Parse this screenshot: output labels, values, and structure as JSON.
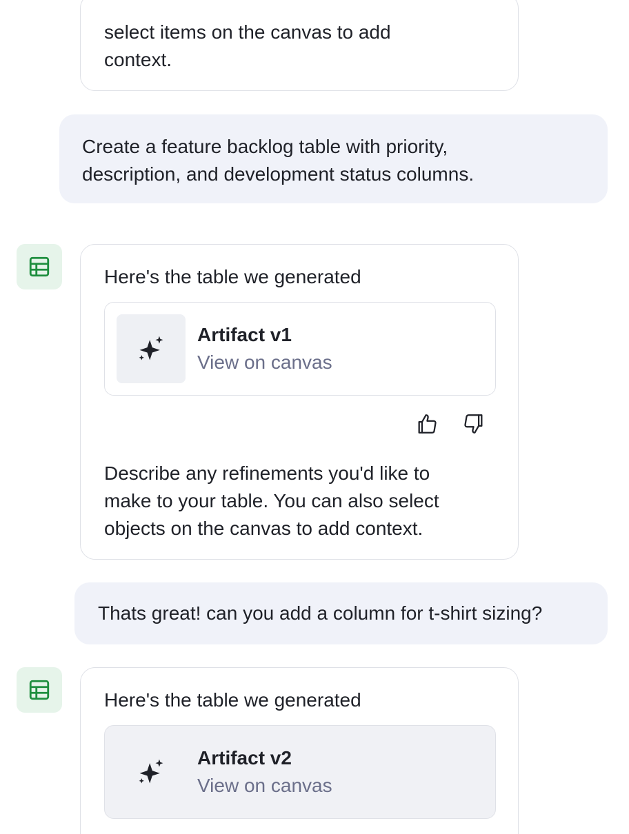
{
  "chat": {
    "msg0": {
      "line1": "select items on the canvas to add",
      "line2": "context."
    },
    "user1": {
      "line1": "Create a feature backlog table with priority,",
      "line2": "description, and development status columns."
    },
    "ai1": {
      "intro": "Here's the table we generated",
      "artifact_title": "Artifact v1",
      "artifact_link": "View on canvas",
      "line1": "Describe any refinements you'd like to",
      "line2": "make to your table. You can also select",
      "line3": "objects on the canvas to add context."
    },
    "user2": {
      "text": "Thats great! can you add a column for t-shirt sizing?"
    },
    "ai2": {
      "intro": "Here's the table we generated",
      "artifact_title": "Artifact v2",
      "artifact_link": "View on canvas"
    }
  },
  "icons": {
    "avatar": "table-icon",
    "artifact": "sparkle-icon",
    "like": "thumbs-up-icon",
    "dislike": "thumbs-down-icon"
  },
  "colors": {
    "avatar_bg": "#e6f4ea",
    "avatar_fg": "#1e8e3e",
    "user_bubble": "#f0f2f9",
    "link": "#6b6f8a"
  }
}
